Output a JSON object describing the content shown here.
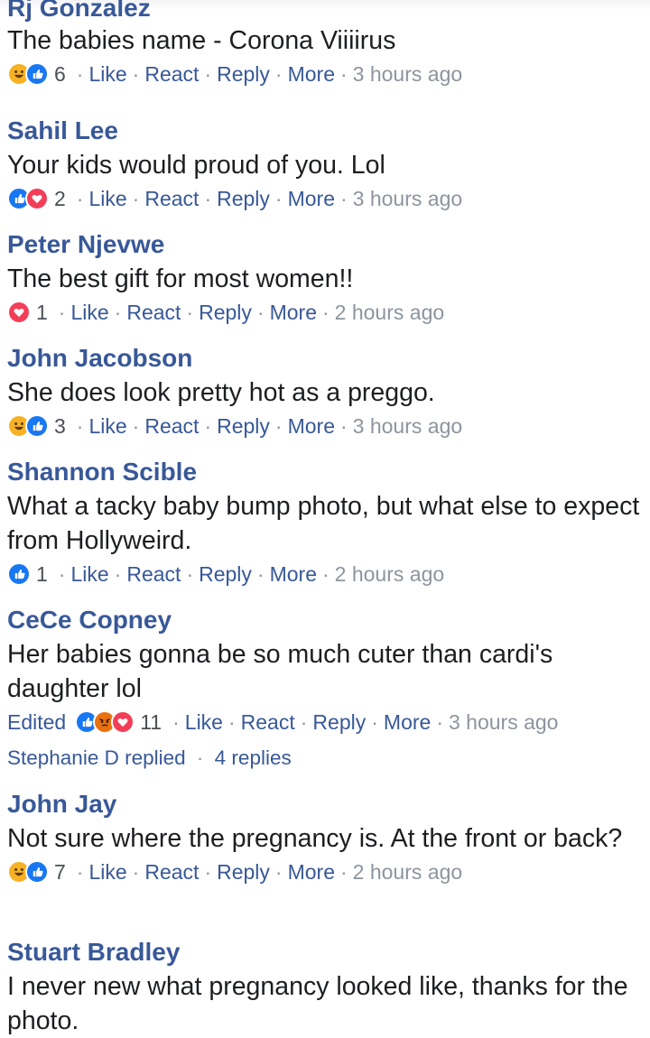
{
  "comments": [
    {
      "author": "Rj Gonzalez",
      "text": "The babies name - Corona Viiiirus",
      "reactions": [
        "haha-icon",
        "like-icon"
      ],
      "count": "6",
      "actions": [
        "Like",
        "React",
        "Reply",
        "More"
      ],
      "time": "3 hours ago"
    },
    {
      "author": "Sahil Lee",
      "text": "Your kids would proud of you. Lol",
      "reactions": [
        "like-icon",
        "love-icon"
      ],
      "count": "2",
      "actions": [
        "Like",
        "React",
        "Reply",
        "More"
      ],
      "time": "3 hours ago"
    },
    {
      "author": "Peter Njevwe",
      "text": "The best gift for most women!!",
      "reactions": [
        "love-icon"
      ],
      "count": "1",
      "actions": [
        "Like",
        "React",
        "Reply",
        "More"
      ],
      "time": "2 hours ago"
    },
    {
      "author": "John Jacobson",
      "text": "She does look pretty hot as a preggo.",
      "reactions": [
        "haha-icon",
        "like-icon"
      ],
      "count": "3",
      "actions": [
        "Like",
        "React",
        "Reply",
        "More"
      ],
      "time": "3 hours ago"
    },
    {
      "author": "Shannon Scible",
      "text": "What a tacky baby bump photo, but what else to expect from Hollyweird.",
      "reactions": [
        "like-icon"
      ],
      "count": "1",
      "actions": [
        "Like",
        "React",
        "Reply",
        "More"
      ],
      "time": "2 hours ago"
    },
    {
      "author": "CeCe Copney",
      "text": "Her babies gonna be so much cuter than cardi's daughter lol",
      "edited": "Edited",
      "reactions": [
        "like-icon",
        "angry-icon",
        "love-icon"
      ],
      "count": "11",
      "actions": [
        "Like",
        "React",
        "Reply",
        "More"
      ],
      "time": "3 hours ago",
      "replies_by": "Stephanie D replied",
      "replies_count": "4 replies"
    },
    {
      "author": "John Jay",
      "text": "Not sure where the pregnancy is. At the front or back?",
      "reactions": [
        "haha-icon",
        "like-icon"
      ],
      "count": "7",
      "actions": [
        "Like",
        "React",
        "Reply",
        "More"
      ],
      "time": "2 hours ago"
    },
    {
      "author": "Stuart Bradley",
      "text": "I never new what pregnancy looked like, thanks for the photo."
    }
  ],
  "colors": {
    "author": "#385898",
    "text": "#1c1e21",
    "meta": "#8d949e",
    "like": "#1877f2",
    "love": "#f33e58",
    "haha": "#f7b125",
    "angry": "#e9710f"
  }
}
